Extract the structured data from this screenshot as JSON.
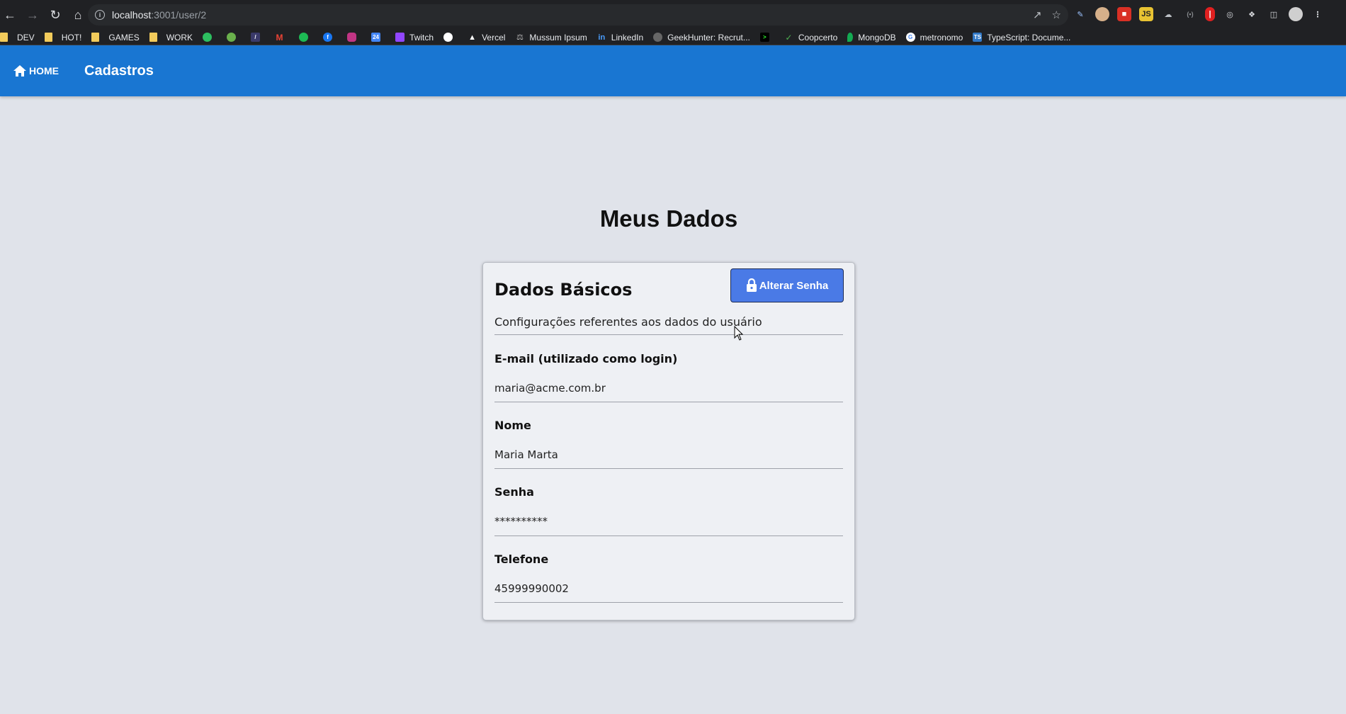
{
  "browser": {
    "url_host": "localhost",
    "url_path": ":3001/user/2",
    "bookmarks": [
      {
        "label": "DEV",
        "type": "folder"
      },
      {
        "label": "HOT!",
        "type": "folder"
      },
      {
        "label": "GAMES",
        "type": "folder"
      },
      {
        "label": "WORK",
        "type": "folder"
      },
      {
        "label": "Twitch",
        "type": "link",
        "color": "#9146ff"
      },
      {
        "label": "Vercel",
        "type": "link",
        "color": "#000000"
      },
      {
        "label": "Mussum Ipsum",
        "type": "link",
        "color": "#777777"
      },
      {
        "label": "LinkedIn",
        "type": "link",
        "color": "#0a66c2"
      },
      {
        "label": "GeekHunter: Recrut...",
        "type": "link",
        "color": "#666666"
      },
      {
        "label": "Coopcerto",
        "type": "link",
        "color": "#2e7d32"
      },
      {
        "label": "MongoDB",
        "type": "link",
        "color": "#13aa52"
      },
      {
        "label": "metronomo",
        "type": "link",
        "color": "#4285f4"
      },
      {
        "label": "TypeScript: Docume...",
        "type": "link",
        "color": "#3178c6"
      }
    ],
    "bookmark_icon_only": [
      {
        "name": "evernote-icon",
        "color": "#2dbe60"
      },
      {
        "name": "android-icon",
        "color": "#6ab04c"
      },
      {
        "name": "pen-icon",
        "color": "#3a3a6a"
      },
      {
        "name": "gmail-icon",
        "color": "#ea4335"
      },
      {
        "name": "spotify-icon",
        "color": "#1db954"
      },
      {
        "name": "facebook-icon",
        "color": "#1877f2"
      },
      {
        "name": "instagram-icon",
        "color": "#c13584"
      },
      {
        "name": "calendar-icon",
        "color": "#4285f4"
      }
    ]
  },
  "header": {
    "home_label": "HOME",
    "app_title": "Cadastros",
    "bg_color": "#1976d2"
  },
  "page": {
    "title": "Meus Dados"
  },
  "card": {
    "title": "Dados Básicos",
    "description": "Configurações referentes aos dados do usuário",
    "change_password_label": "Alterar Senha",
    "fields": [
      {
        "label": "E-mail (utilizado como login)",
        "value": "maria@acme.com.br"
      },
      {
        "label": "Nome",
        "value": "Maria Marta"
      },
      {
        "label": "Senha",
        "value": "**********"
      },
      {
        "label": "Telefone",
        "value": "45999990002"
      }
    ]
  }
}
